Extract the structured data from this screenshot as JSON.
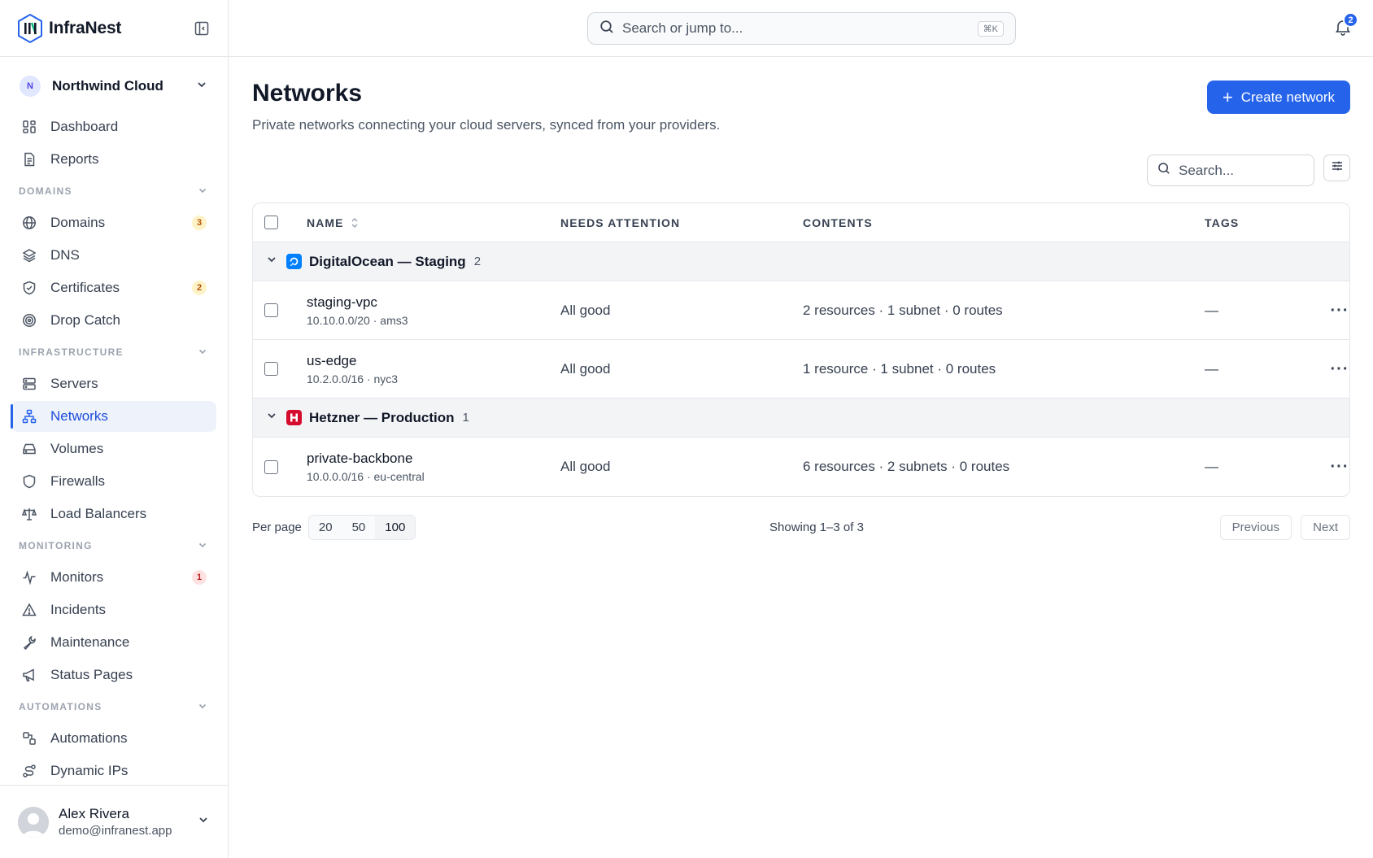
{
  "brand": {
    "name": "InfraNest"
  },
  "org": {
    "initial": "N",
    "name": "Northwind Cloud"
  },
  "nav": {
    "top": [
      {
        "label": "Dashboard",
        "icon": "dashboard-icon"
      },
      {
        "label": "Reports",
        "icon": "report-icon"
      }
    ],
    "sections": [
      {
        "title": "DOMAINS",
        "items": [
          {
            "label": "Domains",
            "icon": "globe-icon",
            "badge": "3"
          },
          {
            "label": "DNS",
            "icon": "layers-icon"
          },
          {
            "label": "Certificates",
            "icon": "shield-check-icon",
            "badge": "2"
          },
          {
            "label": "Drop Catch",
            "icon": "target-icon"
          }
        ]
      },
      {
        "title": "INFRASTRUCTURE",
        "items": [
          {
            "label": "Servers",
            "icon": "server-icon"
          },
          {
            "label": "Networks",
            "icon": "network-icon",
            "active": true
          },
          {
            "label": "Volumes",
            "icon": "drive-icon"
          },
          {
            "label": "Firewalls",
            "icon": "shield-icon"
          },
          {
            "label": "Load Balancers",
            "icon": "scale-icon"
          }
        ]
      },
      {
        "title": "MONITORING",
        "items": [
          {
            "label": "Monitors",
            "icon": "activity-icon",
            "badge": "1"
          },
          {
            "label": "Incidents",
            "icon": "alert-triangle-icon"
          },
          {
            "label": "Maintenance",
            "icon": "wrench-icon"
          },
          {
            "label": "Status Pages",
            "icon": "megaphone-icon"
          }
        ]
      },
      {
        "title": "AUTOMATIONS",
        "items": [
          {
            "label": "Automations",
            "icon": "workflow-icon"
          },
          {
            "label": "Dynamic IPs",
            "icon": "route-icon"
          }
        ]
      }
    ]
  },
  "user": {
    "name": "Alex Rivera",
    "email": "demo@infranest.app"
  },
  "topbar": {
    "search_placeholder": "Search or jump to...",
    "shortcut": "⌘K",
    "notification_count": "2"
  },
  "page": {
    "title": "Networks",
    "subtitle": "Private networks connecting your cloud servers, synced from your providers.",
    "create_label": "Create network",
    "search_placeholder": "Search..."
  },
  "table": {
    "columns": {
      "name": "NAME",
      "attention": "NEEDS ATTENTION",
      "contents": "CONTENTS",
      "tags": "TAGS"
    },
    "groups": [
      {
        "name": "DigitalOcean — Staging",
        "count": "2",
        "provider_color": "#0080ff",
        "rows": [
          {
            "name": "staging-vpc",
            "meta": "10.10.0.0/20 · ams3",
            "attention": "All good",
            "contents": "2 resources · 1 subnet · 0 routes",
            "tags": "—"
          },
          {
            "name": "us-edge",
            "meta": "10.2.0.0/16 · nyc3",
            "attention": "All good",
            "contents": "1 resource · 1 subnet · 0 routes",
            "tags": "—"
          }
        ]
      },
      {
        "name": "Hetzner — Production",
        "count": "1",
        "provider_color": "#d50c2d",
        "rows": [
          {
            "name": "private-backbone",
            "meta": "10.0.0.0/16 · eu-central",
            "attention": "All good",
            "contents": "6 resources · 2 subnets · 0 routes",
            "tags": "—"
          }
        ]
      }
    ]
  },
  "pager": {
    "per_page_label": "Per page",
    "options": [
      "20",
      "50",
      "100"
    ],
    "selected": "100",
    "showing": "Showing 1–3 of 3",
    "prev": "Previous",
    "next": "Next"
  },
  "colors": {
    "accent": "#2563eb"
  }
}
